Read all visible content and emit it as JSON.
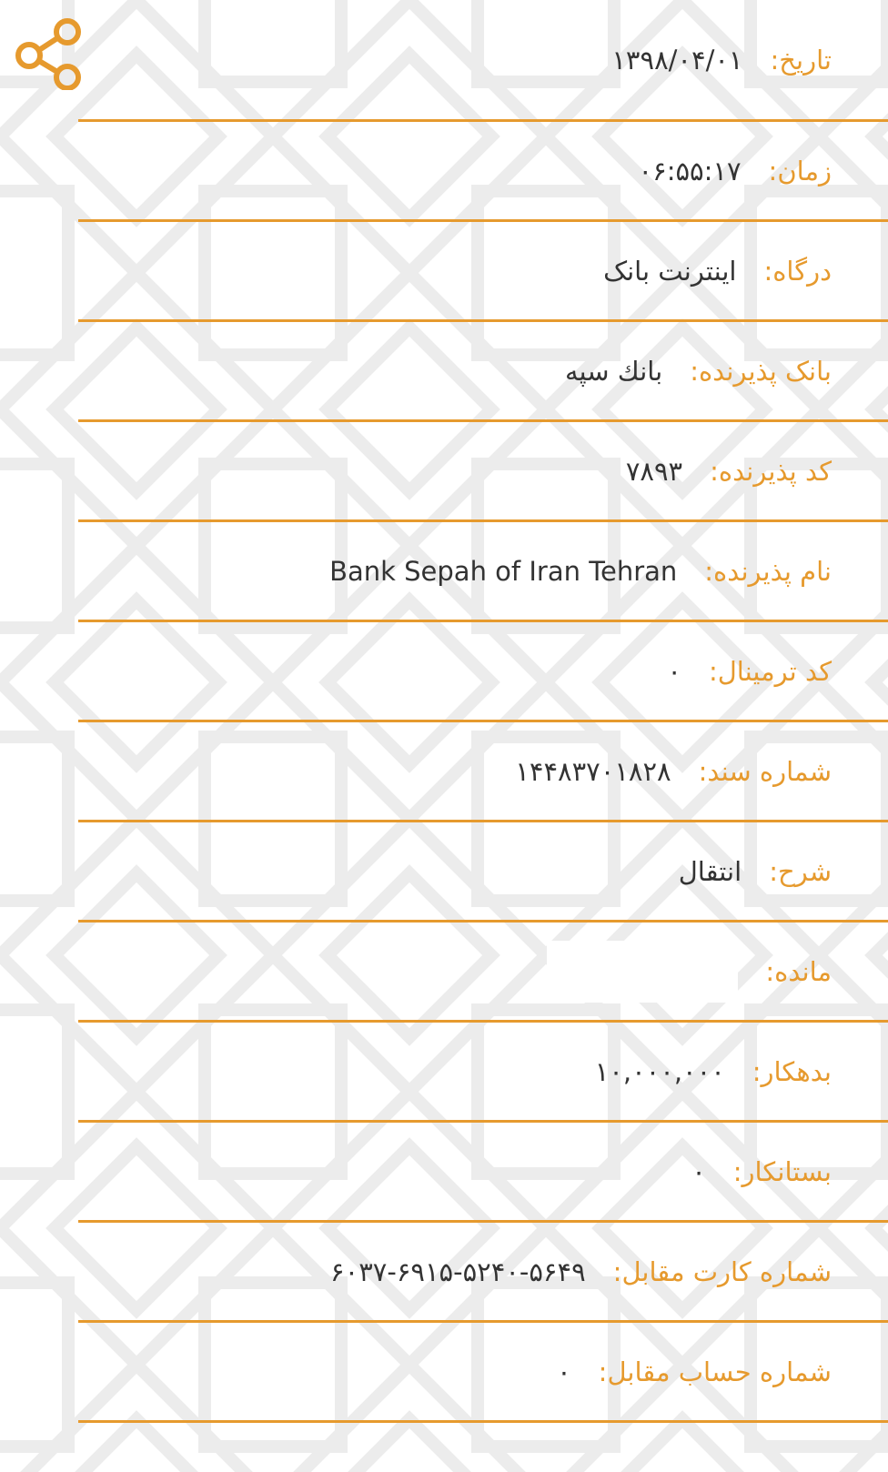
{
  "colors": {
    "accent": "#e69a2e",
    "text": "#333333",
    "background": "#ffffff",
    "pattern": "#ececec"
  },
  "share": {
    "icon": "share-icon"
  },
  "rows": [
    {
      "label": "تاریخ:",
      "value": "۱۳۹۸/۰۴/۰۱"
    },
    {
      "label": "زمان:",
      "value": "۰۶:۵۵:۱۷"
    },
    {
      "label": "درگاه:",
      "value": "اینترنت بانک"
    },
    {
      "label": "بانک پذیرنده:",
      "value": "بانك سپه"
    },
    {
      "label": "کد پذیرنده:",
      "value": "۷۸۹۳"
    },
    {
      "label": "نام پذیرنده:",
      "value": "Bank Sepah of Iran Tehran"
    },
    {
      "label": "کد ترمینال:",
      "value": "۰"
    },
    {
      "label": "شماره سند:",
      "value": "۱۴۴۸۳۷۰۱۸۲۸"
    },
    {
      "label": "شرح:",
      "value": "انتقال"
    },
    {
      "label": "مانده:",
      "value": ""
    },
    {
      "label": "بدهکار:",
      "value": "۱۰,۰۰۰,۰۰۰"
    },
    {
      "label": "بستانکار:",
      "value": "۰"
    },
    {
      "label": "شماره کارت مقابل:",
      "value": "۶۰۳۷-۶۹۱۵-۵۲۴۰-۵۶۴۹"
    },
    {
      "label": "شماره حساب مقابل:",
      "value": "۰"
    }
  ]
}
